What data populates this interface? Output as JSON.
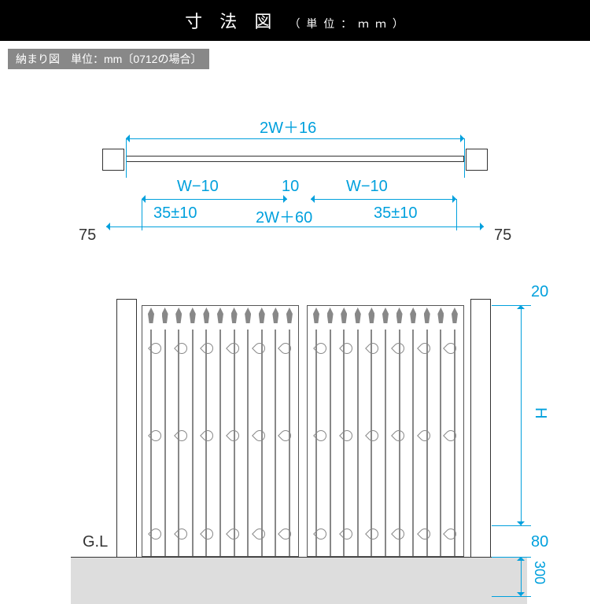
{
  "header": {
    "title": "寸 法 図",
    "unit": "（ 単 位 ： ｍ ｍ ）"
  },
  "subtitle": "納まり図　単位：mm〔0712の場合〕",
  "dims": {
    "top_overall": "2W＋16",
    "w_minus_10_l": "W−10",
    "w_minus_10_r": "W−10",
    "gap_10": "10",
    "tol_l": "35±10",
    "tol_r": "35±10",
    "bottom_span": "2W＋60",
    "side_75_l": "75",
    "side_75_r": "75",
    "v_20": "20",
    "v_H": "H",
    "v_80": "80",
    "v_300": "300",
    "gl": "G.L"
  }
}
